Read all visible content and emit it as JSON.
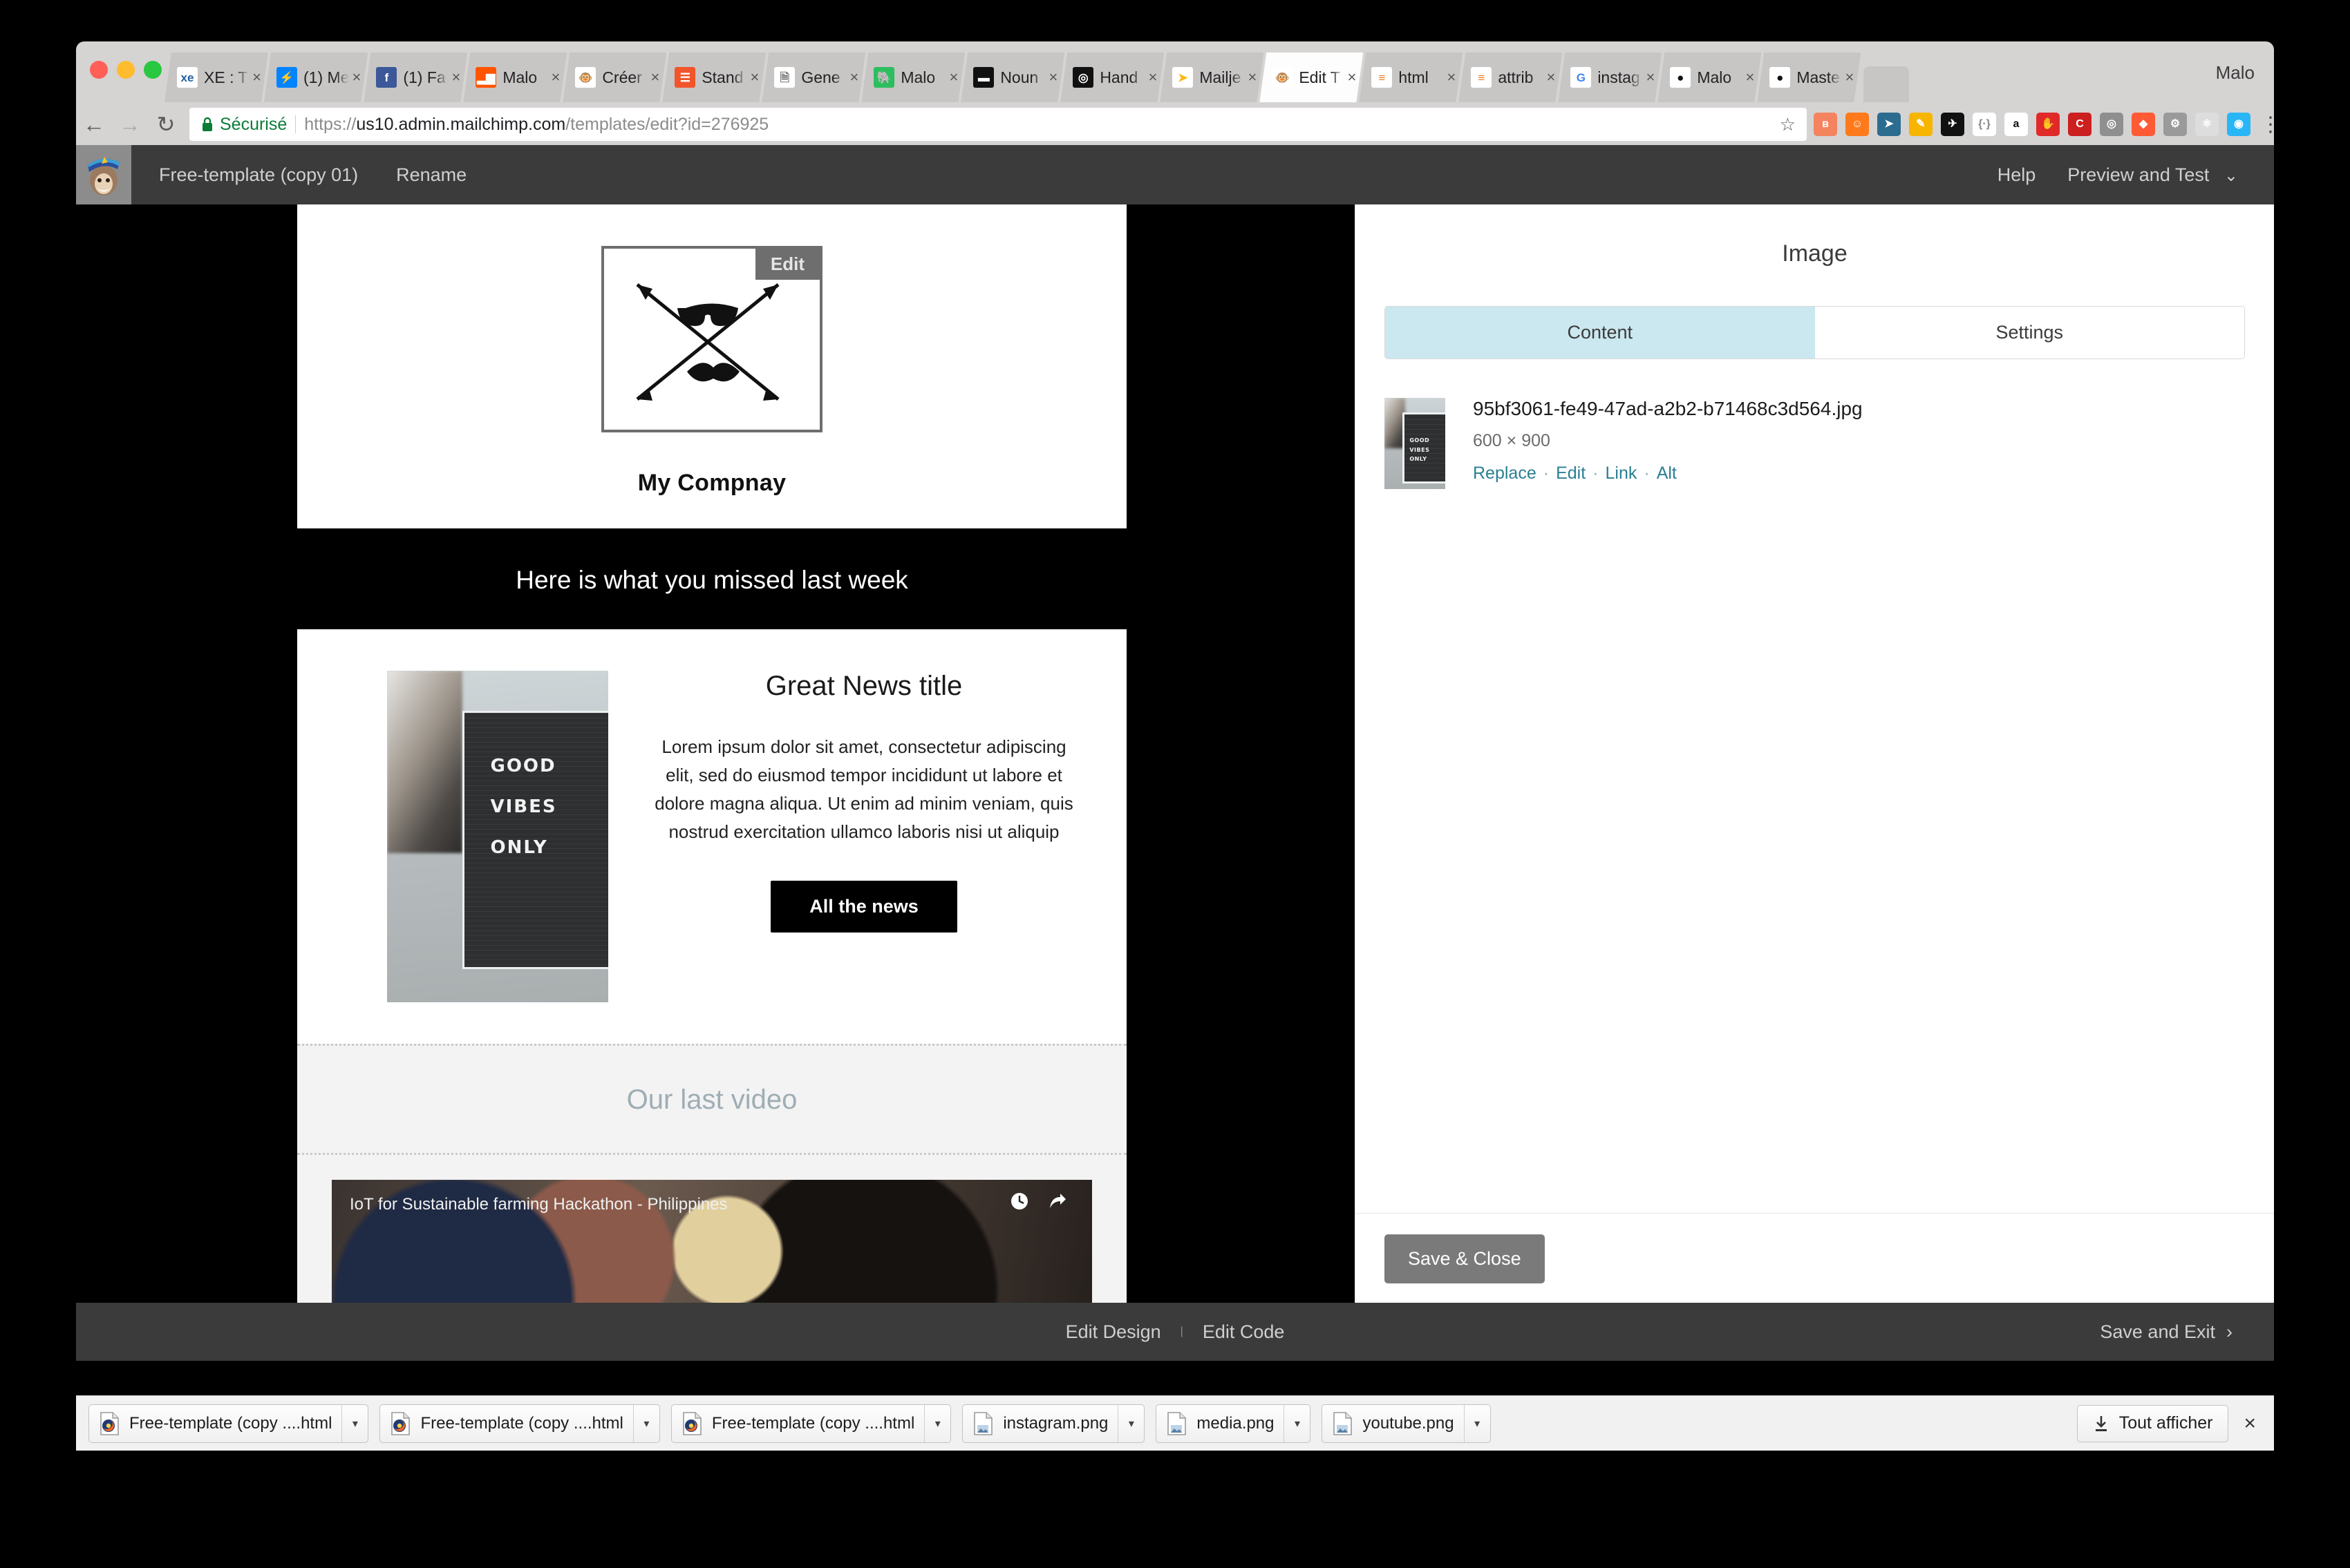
{
  "browser": {
    "profile_name": "Malo",
    "tabs": [
      {
        "label": "XE : T",
        "icon": "xe-icon",
        "active": false,
        "color": "#ffffff",
        "glyph": "xe",
        "glyph_color": "#1f5fa0"
      },
      {
        "label": "(1) Me",
        "icon": "messenger-icon",
        "active": false,
        "color": "#0084ff",
        "glyph": "⚡",
        "glyph_color": "#ffffff"
      },
      {
        "label": "(1) Fa",
        "icon": "facebook-icon",
        "active": false,
        "color": "#3b5998",
        "glyph": "f",
        "glyph_color": "#ffffff"
      },
      {
        "label": "Malo",
        "icon": "soundcloud-icon",
        "active": false,
        "color": "#ff5500",
        "glyph": "▂▆",
        "glyph_color": "#ffffff"
      },
      {
        "label": "Créer",
        "icon": "mailchimp-icon",
        "active": false,
        "color": "#ffffff",
        "glyph": "🐵",
        "glyph_color": "#000000"
      },
      {
        "label": "Stand",
        "icon": "standard-icon",
        "active": false,
        "color": "#f2552c",
        "glyph": "☰",
        "glyph_color": "#ffffff"
      },
      {
        "label": "Gene",
        "icon": "document-icon",
        "active": false,
        "color": "#ffffff",
        "glyph": "🗎",
        "glyph_color": "#777777"
      },
      {
        "label": "Malo",
        "icon": "evernote-icon",
        "active": false,
        "color": "#2dbe60",
        "glyph": "🐘",
        "glyph_color": "#ffffff"
      },
      {
        "label": "Noun",
        "icon": "nounproject-icon",
        "active": false,
        "color": "#111111",
        "glyph": "▬",
        "glyph_color": "#ffffff"
      },
      {
        "label": "Hand",
        "icon": "handbag-icon",
        "active": false,
        "color": "#111111",
        "glyph": "◎",
        "glyph_color": "#ffffff"
      },
      {
        "label": "Mailje",
        "icon": "mailjet-icon",
        "active": false,
        "color": "#ffffff",
        "glyph": "➤",
        "glyph_color": "#fdb913"
      },
      {
        "label": "Edit T",
        "icon": "mailchimp-icon",
        "active": true,
        "color": "#ffffff",
        "glyph": "🐵",
        "glyph_color": "#000000"
      },
      {
        "label": "html",
        "icon": "stackoverflow-icon",
        "active": false,
        "color": "#ffffff",
        "glyph": "≡",
        "glyph_color": "#f48024"
      },
      {
        "label": "attrib",
        "icon": "stackoverflow-icon",
        "active": false,
        "color": "#ffffff",
        "glyph": "≡",
        "glyph_color": "#f48024"
      },
      {
        "label": "instag",
        "icon": "google-icon",
        "active": false,
        "color": "#ffffff",
        "glyph": "G",
        "glyph_color": "#4285f4"
      },
      {
        "label": "Malo",
        "icon": "github-icon",
        "active": false,
        "color": "#ffffff",
        "glyph": "●",
        "glyph_color": "#111111"
      },
      {
        "label": "Maste",
        "icon": "github-icon",
        "active": false,
        "color": "#ffffff",
        "glyph": "●",
        "glyph_color": "#111111"
      }
    ],
    "close_glyph": "×",
    "nav": {
      "back": "←",
      "forward": "→",
      "reload": "↻"
    },
    "omnibox": {
      "lock_glyph": "🔒",
      "secure_label": "Sécurisé",
      "url_scheme": "https://",
      "url_domain": "us10.admin.mailchimp.com",
      "url_path": "/templates/edit?id=276925",
      "star_glyph": "☆"
    },
    "extensions": [
      {
        "name": "d3-icon",
        "glyph": "ʙ",
        "bg": "#f4845f",
        "fg": "#ffffff"
      },
      {
        "name": "flame-icon",
        "glyph": "☺",
        "bg": "#ff7a1a",
        "fg": "#ffffff"
      },
      {
        "name": "compass-icon",
        "glyph": "➤",
        "bg": "#2c6c8f",
        "fg": "#ffffff"
      },
      {
        "name": "colorpicker-icon",
        "glyph": "✎",
        "bg": "#f7b500",
        "fg": "#ffffff"
      },
      {
        "name": "bird-icon",
        "glyph": "✈",
        "bg": "#111111",
        "fg": "#ffffff"
      },
      {
        "name": "json-icon",
        "glyph": "{·}",
        "bg": "#ffffff",
        "fg": "#888888"
      },
      {
        "name": "amazon-icon",
        "glyph": "a",
        "bg": "#ffffff",
        "fg": "#111111"
      },
      {
        "name": "adblock-icon",
        "glyph": "✋",
        "bg": "#e02a2a",
        "fg": "#ffffff"
      },
      {
        "name": "cors-icon",
        "glyph": "C",
        "bg": "#cc1f1f",
        "fg": "#ffffff"
      },
      {
        "name": "screenshot-icon",
        "glyph": "◎",
        "bg": "#8f8f8f",
        "fg": "#ffffff"
      },
      {
        "name": "pocket-icon",
        "glyph": "◆",
        "bg": "#ff5a36",
        "fg": "#ffffff"
      },
      {
        "name": "gear-icon",
        "glyph": "⚙",
        "bg": "#9a9a9a",
        "fg": "#ffffff"
      },
      {
        "name": "react-icon",
        "glyph": "⚛",
        "bg": "#dddddd",
        "fg": "#ffffff"
      },
      {
        "name": "eye-icon",
        "glyph": "◉",
        "bg": "#29b6f6",
        "fg": "#ffffff"
      }
    ],
    "menu_glyph": "⋮"
  },
  "app_header": {
    "logo_name": "mailchimp-monkey-logo",
    "template_name": "Free-template (copy 01)",
    "rename_label": "Rename",
    "help_label": "Help",
    "preview_label": "Preview and Test",
    "preview_caret": "⌄"
  },
  "email": {
    "logo_edit_label": "Edit",
    "company_name": "My Compnay",
    "section_heading": "Here is what you missed last week",
    "news": {
      "title": "Great News title",
      "body": "Lorem ipsum dolor sit amet, consectetur adipiscing elit, sed do eiusmod tempor incididunt ut labore et dolore magna aliqua. Ut enim ad minim veniam, quis nostrud exercitation ullamco laboris nisi ut aliquip",
      "button_label": "All the news",
      "photo_lines": [
        "GOOD",
        "VIBES",
        "ONLY"
      ]
    },
    "video": {
      "section_title": "Our last video",
      "caption": "IoT for Sustainable farming Hackathon - Philippines",
      "watch_later_icon": "clock-icon",
      "share_icon": "share-icon"
    }
  },
  "sidebar": {
    "title": "Image",
    "tabs": [
      {
        "label": "Content",
        "active": true
      },
      {
        "label": "Settings",
        "active": false
      }
    ],
    "asset": {
      "filename": "95bf3061-fe49-47ad-a2b2-b71468c3d564.jpg",
      "dimensions": "600 × 900",
      "actions": [
        "Replace",
        "Edit",
        "Link",
        "Alt"
      ],
      "action_separator": "·",
      "thumb_lines": [
        "GOOD",
        "VIBES",
        "ONLY"
      ]
    },
    "save_close_label": "Save & Close"
  },
  "app_footer": {
    "edit_design_label": "Edit Design",
    "separator": "|",
    "edit_code_label": "Edit Code",
    "save_exit_label": "Save and Exit",
    "save_exit_caret": "›"
  },
  "download_shelf": {
    "items": [
      {
        "name": "Free-template (copy ....html",
        "icon": "firefox-html-icon"
      },
      {
        "name": "Free-template (copy ....html",
        "icon": "firefox-html-icon"
      },
      {
        "name": "Free-template (copy ....html",
        "icon": "firefox-html-icon"
      },
      {
        "name": "instagram.png",
        "icon": "image-file-icon"
      },
      {
        "name": "media.png",
        "icon": "image-file-icon"
      },
      {
        "name": "youtube.png",
        "icon": "image-file-icon"
      }
    ],
    "caret_glyph": "▾",
    "show_all_label": "Tout afficher",
    "show_all_icon": "download-icon",
    "close_glyph": "×"
  },
  "colors": {
    "chrome_bg": "#d6d3d3",
    "app_dark": "#3b3b3b",
    "tab_active_bg": "#cbe7ef",
    "link_teal": "#2a7f93",
    "secure_green": "#0b7d37"
  }
}
